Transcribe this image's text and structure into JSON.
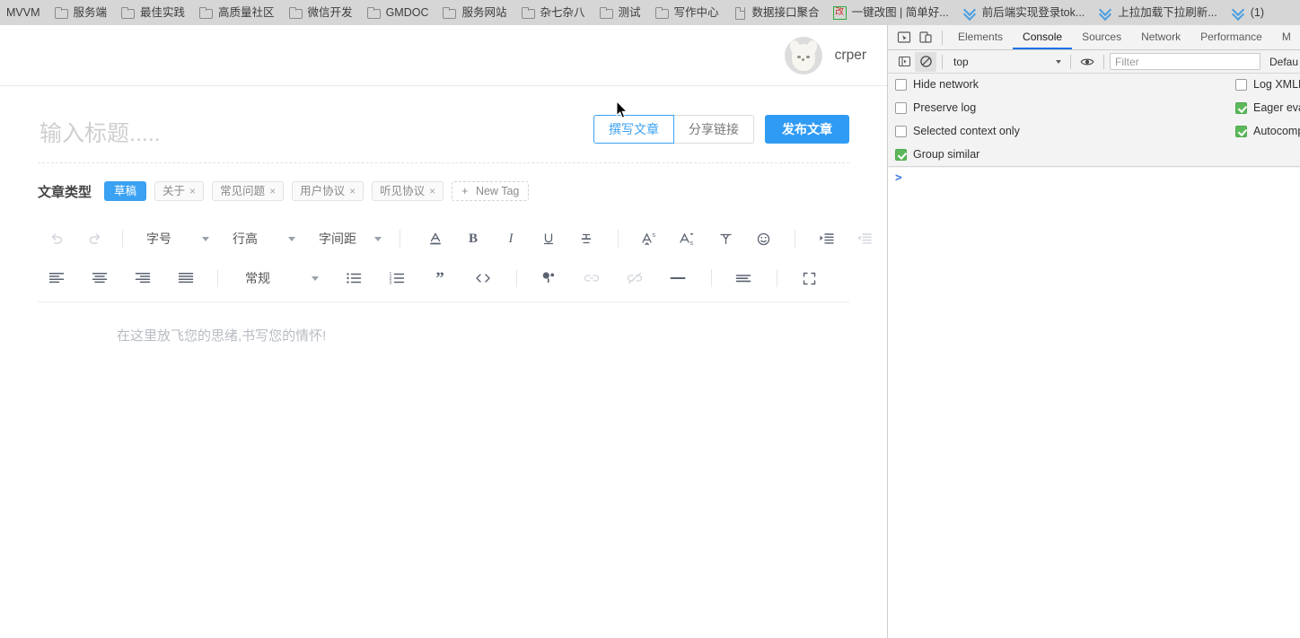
{
  "bookmarks": [
    {
      "label": "MVVM",
      "icon": "none"
    },
    {
      "label": "服务端",
      "icon": "folder-icon"
    },
    {
      "label": "最佳实践",
      "icon": "folder-icon"
    },
    {
      "label": "高质量社区",
      "icon": "folder-icon"
    },
    {
      "label": "微信开发",
      "icon": "folder-icon"
    },
    {
      "label": "GMDOC",
      "icon": "folder-icon"
    },
    {
      "label": "服务网站",
      "icon": "folder-icon"
    },
    {
      "label": "杂七杂八",
      "icon": "folder-icon"
    },
    {
      "label": "测试",
      "icon": "folder-icon"
    },
    {
      "label": "写作中心",
      "icon": "folder-icon"
    },
    {
      "label": "数据接口聚合",
      "icon": "page-icon"
    },
    {
      "label": "一键改图 | 简单好...",
      "icon": "green-box-icon",
      "icon_text": "改"
    },
    {
      "label": "前后端实现登录tok...",
      "icon": "chevron-icon"
    },
    {
      "label": "上拉加载下拉刷新...",
      "icon": "chevron-icon"
    },
    {
      "label": "(1)",
      "icon": "chevron-icon"
    }
  ],
  "page": {
    "user": {
      "name": "crper",
      "avatar_alt": "avatar"
    },
    "title_placeholder": "输入标题.....",
    "title_value": "",
    "actions": {
      "write_article": "撰写文章",
      "share_link": "分享链接",
      "publish": "发布文章"
    },
    "tags": {
      "label": "文章类型",
      "items": [
        {
          "text": "草稿",
          "selected": true,
          "closable": false
        },
        {
          "text": "关于",
          "selected": false,
          "closable": true
        },
        {
          "text": "常见问题",
          "selected": false,
          "closable": true
        },
        {
          "text": "用户协议",
          "selected": false,
          "closable": true
        },
        {
          "text": "听见协议",
          "selected": false,
          "closable": true
        }
      ],
      "new_tag": "New Tag"
    },
    "toolbar": {
      "font_size": "字号",
      "line_height": "行高",
      "letter_spacing": "字间距",
      "paragraph_style": "常规"
    },
    "editor_placeholder": "在这里放飞您的思绪,书写您的情怀!"
  },
  "devtools": {
    "tabs": [
      {
        "label": "Elements",
        "active": false
      },
      {
        "label": "Console",
        "active": true
      },
      {
        "label": "Sources",
        "active": false
      },
      {
        "label": "Network",
        "active": false
      },
      {
        "label": "Performance",
        "active": false
      },
      {
        "label": "M",
        "active": false
      }
    ],
    "console_toolbar": {
      "context": "top",
      "filter_placeholder": "Filter",
      "filter_value": "",
      "levels": "Defau"
    },
    "settings_left": [
      {
        "label": "Hide network",
        "checked": false
      },
      {
        "label": "Preserve log",
        "checked": false
      },
      {
        "label": "Selected context only",
        "checked": false
      },
      {
        "label": "Group similar",
        "checked": true
      }
    ],
    "settings_right": [
      {
        "label": "Log XMLH",
        "checked": false
      },
      {
        "label": "Eager eva",
        "checked": true
      },
      {
        "label": "Autocomp",
        "checked": true
      }
    ],
    "prompt": ">"
  },
  "colors": {
    "accent_blue": "#2f9bf5",
    "tab_active_blue": "#1a73e8",
    "checkbox_green": "#5db85c",
    "bookmark_bar_bg": "#d6d6d6"
  }
}
